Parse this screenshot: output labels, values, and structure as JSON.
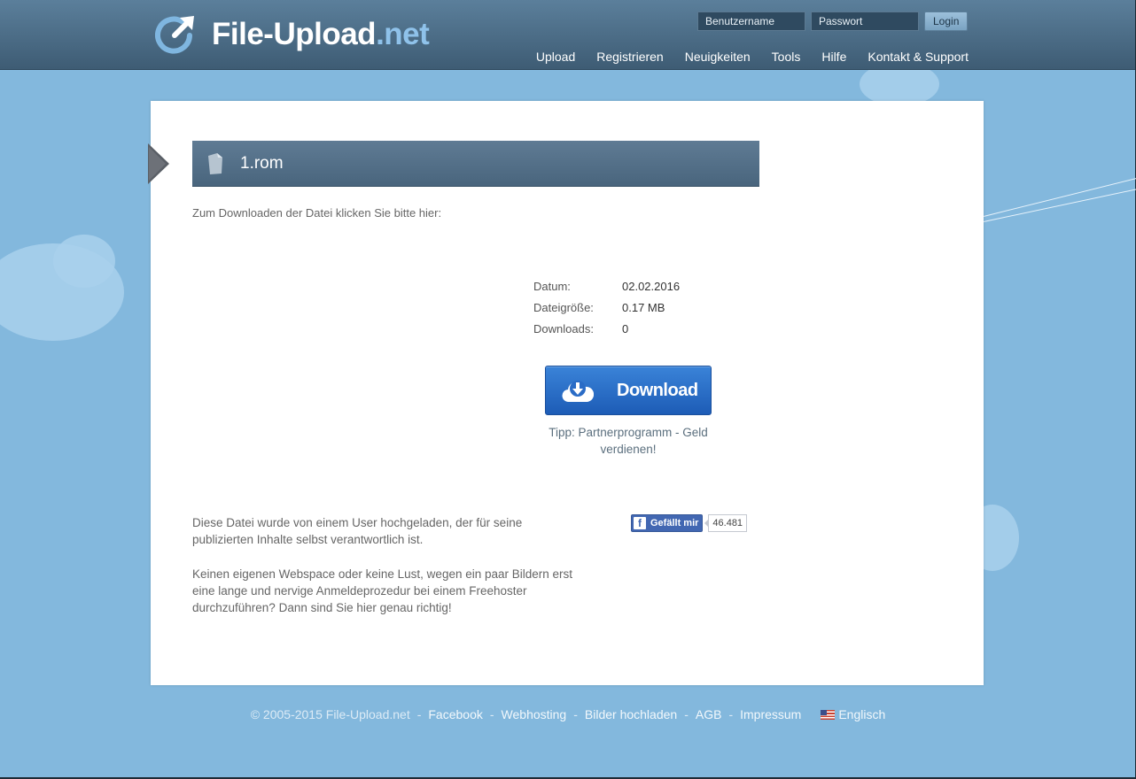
{
  "header": {
    "logo_name": "File-Upload",
    "logo_tld": ".net",
    "login": {
      "username_placeholder": "Benutzername",
      "password_placeholder": "Passwort",
      "button_label": "Login"
    },
    "nav": [
      {
        "label": "Upload"
      },
      {
        "label": "Registrieren"
      },
      {
        "label": "Neuigkeiten"
      },
      {
        "label": "Tools"
      },
      {
        "label": "Hilfe"
      },
      {
        "label": "Kontakt & Support"
      }
    ]
  },
  "file": {
    "name": "1.rom",
    "instruction": "Zum Downloaden der Datei klicken Sie bitte hier:",
    "meta": [
      {
        "label": "Datum:",
        "value": "02.02.2016"
      },
      {
        "label": "Dateigröße:",
        "value": "0.17 MB"
      },
      {
        "label": "Downloads:",
        "value": "0"
      }
    ],
    "download_label": "Download",
    "tip": "Tipp: Partnerprogramm - Geld verdienen!"
  },
  "info": {
    "disclaimer": "Diese Datei wurde von einem User hochgeladen, der für seine publizierten Inhalte selbst verantwortlich ist.",
    "pitch": "Keinen eigenen Webspace oder keine Lust, wegen ein paar Bildern erst eine lange und nervige Anmeldeprozedur bei einem Freehoster durchzuführen? Dann sind Sie hier genau richtig!"
  },
  "facebook": {
    "like_label": "Gefällt mir",
    "count": "46.481"
  },
  "footer": {
    "copyright": "© 2005-2015 File-Upload.net",
    "links": [
      "Facebook",
      "Webhosting",
      "Bilder hochladen",
      "AGB",
      "Impressum"
    ],
    "language": "Englisch"
  },
  "colors": {
    "background": "#83b8dd",
    "header": "#4a6b85",
    "download_button": "#2b6fc8",
    "facebook": "#4267b2"
  }
}
